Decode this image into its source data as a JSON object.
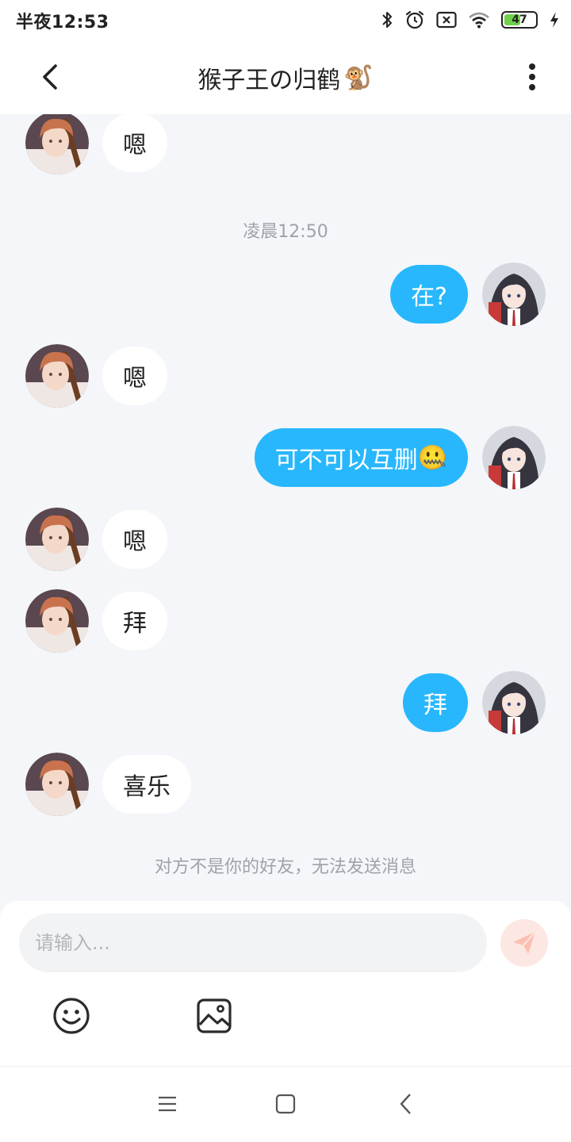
{
  "status": {
    "time": "半夜12:53",
    "battery": "47",
    "icons": [
      "bluetooth-icon",
      "alarm-icon",
      "no-sim-icon",
      "wifi-icon",
      "battery-icon",
      "charging-icon"
    ]
  },
  "header": {
    "title": "猴子王の归鹤",
    "title_emoji": "🐒"
  },
  "chat": {
    "timestamp": "凌晨12:50",
    "messages": [
      {
        "side": "in",
        "text": "嗯"
      },
      {
        "side": "out",
        "text": "在?"
      },
      {
        "side": "in",
        "text": "嗯"
      },
      {
        "side": "out",
        "text": "可不可以互删",
        "emoji": "🤐"
      },
      {
        "side": "in",
        "text": "嗯"
      },
      {
        "side": "in",
        "text": "拜"
      },
      {
        "side": "out",
        "text": "拜"
      },
      {
        "side": "in",
        "text": "喜乐"
      }
    ],
    "notice": "对方不是你的好友，无法发送消息"
  },
  "input": {
    "placeholder": "请输入..."
  },
  "colors": {
    "accent": "#28b7fd",
    "chat_background": "#f4f6f9",
    "send_button": "#fde7e2",
    "send_icon": "#fbbfb2"
  }
}
